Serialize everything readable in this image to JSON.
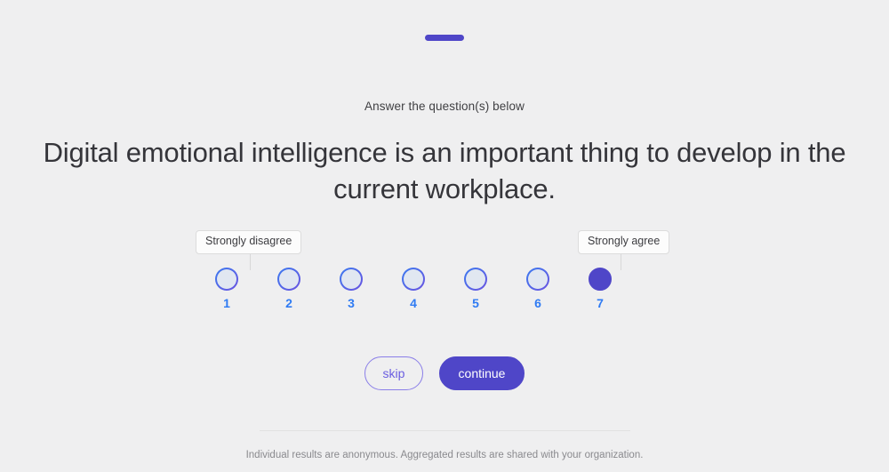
{
  "theme": {
    "background": "#efeff0",
    "accent": "#4f46c8",
    "accent_light": "#8a7ee8",
    "number_color": "#2f7bf3",
    "dot_fill": "#e1e7f1",
    "text_dark": "#35353a",
    "text_muted": "#8a8a8e"
  },
  "progress": {
    "label": ""
  },
  "survey": {
    "prompt": "Answer the question(s) below",
    "question": "Digital emotional intelligence is an important thing to develop in the current workplace.",
    "scale": {
      "low_label": "Strongly disagree",
      "high_label": "Strongly agree",
      "options": [
        {
          "value": "1",
          "selected": false
        },
        {
          "value": "2",
          "selected": false
        },
        {
          "value": "3",
          "selected": false
        },
        {
          "value": "4",
          "selected": false
        },
        {
          "value": "5",
          "selected": false
        },
        {
          "value": "6",
          "selected": false
        },
        {
          "value": "7",
          "selected": true
        }
      ],
      "selected_value": "7"
    },
    "actions": {
      "skip_label": "skip",
      "continue_label": "continue"
    },
    "footer_note": "Individual results are anonymous. Aggregated results are shared with your organization."
  }
}
